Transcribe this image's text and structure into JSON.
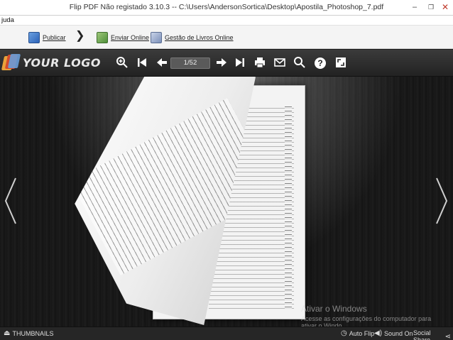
{
  "window": {
    "title": "Flip PDF Não registado 3.10.3  -- C:\\Users\\AndersonSortica\\Desktop\\Apostila_Photoshop_7.pdf",
    "min_glyph": "–",
    "max_glyph": "❐",
    "close_glyph": "✕"
  },
  "menu": {
    "help": "juda"
  },
  "toolbar": {
    "publish": "Publicar",
    "separator": "❯",
    "send_online": "Enviar Online",
    "manage_books": "Gestão de Livros Online"
  },
  "viewer": {
    "logo_text": "YOUR LOGO",
    "page_indicator": "1/52",
    "icons": [
      "zoom-in-icon",
      "first-page-icon",
      "prev-page-icon",
      "next-page-icon",
      "last-page-icon",
      "print-icon",
      "email-icon",
      "search-icon",
      "help-icon",
      "fullscreen-icon"
    ]
  },
  "watermark": {
    "line1": "Ativar o Windows",
    "line2": "Acesse as configurações do computador para",
    "line3": "ativar o Windo"
  },
  "bottombar": {
    "thumbnails": "THUMBNAILS",
    "auto_flip": "Auto Flip",
    "sound_on": "Sound On",
    "social_share": "Social Share"
  },
  "colors": {
    "header_bg": "#2e2e2e",
    "stage_bg": "#171717",
    "logo_orange": "#e9a23b",
    "logo_red": "#d44b2c",
    "logo_blue": "#6a9ed8"
  }
}
